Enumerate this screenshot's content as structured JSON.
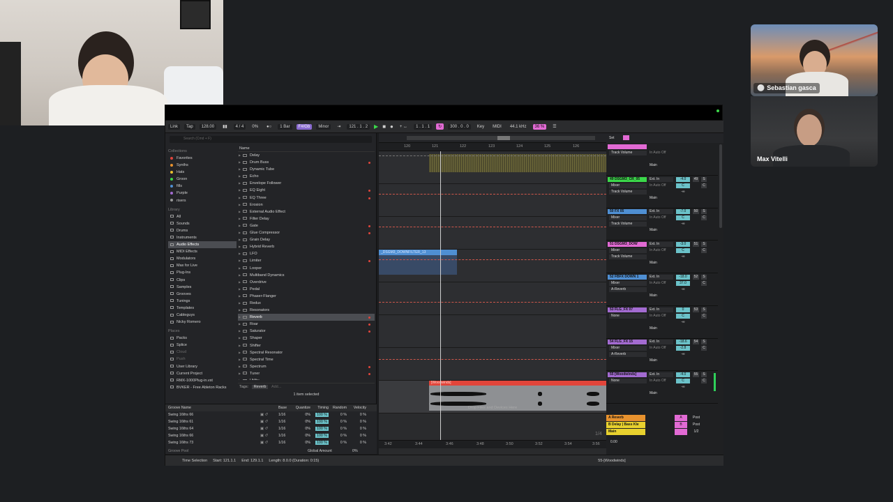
{
  "call": {
    "participants": [
      {
        "name": "Sebastian gasca",
        "muted": true
      },
      {
        "name": "Max Vitelli",
        "muted": false
      }
    ]
  },
  "control_bar": {
    "link": "Link",
    "tap": "Tap",
    "tempo": "128.00",
    "time_signature": "4 / 4",
    "percent": "0%",
    "loop_len": "1 Bar",
    "key": "F#/Gb",
    "scale": "Minor",
    "position": "121 .  1 .  2",
    "loop_start": "1 .  1 .  1",
    "loop_end": "300 .  0 .  0",
    "key_btn": "Key",
    "midi": "MIDI",
    "sample_rate": "44.1 kHz",
    "cpu": "36 %"
  },
  "browser": {
    "search_placeholder": "Search (Cmd + F)",
    "sidebar": {
      "collections_title": "Collections",
      "collections": [
        {
          "label": "Favorites",
          "color": "#e0453c"
        },
        {
          "label": "Synths",
          "color": "#e8922e"
        },
        {
          "label": "Hats",
          "color": "#e8c12e"
        },
        {
          "label": "Groon",
          "color": "#3bd84a"
        },
        {
          "label": "fills",
          "color": "#4f8fd3"
        },
        {
          "label": "Purple",
          "color": "#a36bd1"
        },
        {
          "label": "risers",
          "color": "#9a9a9a"
        }
      ],
      "library_title": "Library",
      "library": [
        "All",
        "Sounds",
        "Drums",
        "Instruments",
        "Audio Effects",
        "MIDI Effects",
        "Modulators",
        "Max for Live",
        "Plug-Ins",
        "Clips",
        "Samples",
        "Grooves",
        "Tunings",
        "Templates",
        "Cableguys",
        "Nicky Romero"
      ],
      "library_selected": 4,
      "places_title": "Places",
      "places": [
        "Packs",
        "Splice",
        "Cloud",
        "Push",
        "User Library",
        "Current Project",
        "RMX-1000Plug-in.vst",
        "BVKER - Free Ableton Racks"
      ]
    },
    "name_header": "Name",
    "items": [
      {
        "label": "Delay",
        "dot": false
      },
      {
        "label": "Drum Buss",
        "dot": true
      },
      {
        "label": "Dynamic Tube",
        "dot": false
      },
      {
        "label": "Echo",
        "dot": false
      },
      {
        "label": "Envelope Follower",
        "dot": false
      },
      {
        "label": "EQ Eight",
        "dot": true
      },
      {
        "label": "EQ Three",
        "dot": true
      },
      {
        "label": "Erosion",
        "dot": false
      },
      {
        "label": "External Audio Effect",
        "dot": false
      },
      {
        "label": "Filter Delay",
        "dot": false
      },
      {
        "label": "Gate",
        "dot": true
      },
      {
        "label": "Glue Compressor",
        "dot": true
      },
      {
        "label": "Grain Delay",
        "dot": false
      },
      {
        "label": "Hybrid Reverb",
        "dot": false
      },
      {
        "label": "LFO",
        "dot": false
      },
      {
        "label": "Limiter",
        "dot": true
      },
      {
        "label": "Looper",
        "dot": false
      },
      {
        "label": "Multiband Dynamics",
        "dot": false
      },
      {
        "label": "Overdrive",
        "dot": false
      },
      {
        "label": "Pedal",
        "dot": false
      },
      {
        "label": "Phaser-Flanger",
        "dot": false
      },
      {
        "label": "Redux",
        "dot": false
      },
      {
        "label": "Resonators",
        "dot": false
      },
      {
        "label": "Reverb",
        "dot": true
      },
      {
        "label": "Roar",
        "dot": true
      },
      {
        "label": "Saturator",
        "dot": true
      },
      {
        "label": "Shaper",
        "dot": false
      },
      {
        "label": "Shifter",
        "dot": false
      },
      {
        "label": "Spectral Resonator",
        "dot": false
      },
      {
        "label": "Spectral Time",
        "dot": false
      },
      {
        "label": "Spectrum",
        "dot": true
      },
      {
        "label": "Tuner",
        "dot": true
      },
      {
        "label": "Utility",
        "dot": true
      }
    ],
    "selected_index": 23,
    "tags_label": "Tags:",
    "tag_value": "Reverb",
    "tag_add": "Add...",
    "selected_count": "1 item selected"
  },
  "groove_pool": {
    "headers": {
      "name": "Groove Name",
      "base": "Base",
      "quantize": "Quantize",
      "timing": "Timing",
      "random": "Random",
      "velocity": "Velocity"
    },
    "rows": [
      {
        "name": "Swing 16ths 66",
        "base": "1/16",
        "quantize": "0%",
        "timing": "100 %",
        "random": "0 %",
        "velocity": "0 %"
      },
      {
        "name": "Swing 16ths 61",
        "base": "1/16",
        "quantize": "0%",
        "timing": "100 %",
        "random": "0 %",
        "velocity": "0 %"
      },
      {
        "name": "Swing 16ths 64",
        "base": "1/16",
        "quantize": "0%",
        "timing": "100 %",
        "random": "0 %",
        "velocity": "0 %"
      },
      {
        "name": "Swing 16ths 66",
        "base": "1/16",
        "quantize": "0%",
        "timing": "100 %",
        "random": "0 %",
        "velocity": "0 %"
      },
      {
        "name": "Swing 16ths 73",
        "base": "1/16",
        "quantize": "0%",
        "timing": "100 %",
        "random": "0 %",
        "velocity": "0 %"
      }
    ],
    "footer_label": "Groove Pool",
    "global_amount_label": "Global Amount",
    "global_amount": "0%"
  },
  "arrangement": {
    "bar_ticks": [
      "120",
      "121",
      "122",
      "123",
      "124",
      "125",
      "126"
    ],
    "time_ticks": [
      "3:42",
      "3:44",
      "3:46",
      "3:48",
      "3:50",
      "3:52",
      "3:54",
      "3:56"
    ],
    "clip_blue_label": "_DSGM3_DOWNFILTER_13",
    "clip_red_label": "[Woodwinds]",
    "drop_hint": "Drop Files and Devices Here",
    "time_sig_display": "1/4"
  },
  "mixer": {
    "set_label": "Set",
    "strips": [
      {
        "name": "",
        "color": "#e26ad4",
        "sel1": "Track Volume",
        "sel2": "",
        "io": "",
        "num": "",
        "vol": "",
        "pan": "",
        "out": "Main"
      },
      {
        "name": "49 DSGM3_CR_05",
        "color": "#3bd84a",
        "sel1": "Mixer",
        "sel2": "Track Volume",
        "io": "Ext. In",
        "num": "49",
        "vol": "-4.0",
        "pan": "C",
        "out": "Main"
      },
      {
        "name": "50 FX 05",
        "color": "#4f8fd3",
        "sel1": "Mixer",
        "sel2": "Track Volume",
        "io": "Ext. In",
        "num": "50",
        "vol": "-7.0",
        "pan": "C",
        "out": "Main"
      },
      {
        "name": "51 DSGM3_DOW",
        "color": "#e26ad4",
        "sel1": "Mixer",
        "sel2": "Track Volume",
        "io": "Ext. In",
        "num": "51",
        "vol": "-3.0",
        "pan": "C",
        "out": "Main"
      },
      {
        "name": "52 FBFX DOWN 1",
        "color": "#4f8fd3",
        "sel1": "Mixer",
        "sel2": "A-Reverb",
        "io": "Ext. In",
        "num": "52",
        "vol": "-18.0",
        "pan": "37.0",
        "out": "Main"
      },
      {
        "name": "53 FLG_FX 07",
        "color": "#a36bd1",
        "sel1": "None",
        "sel2": "",
        "io": "Ext. In",
        "num": "53",
        "vol": "0",
        "pan": "C",
        "out": "Main"
      },
      {
        "name": "54 FLG_FX 15",
        "color": "#a36bd1",
        "sel1": "Mixer",
        "sel2": "A-Reverb",
        "io": "Ext. In",
        "num": "54",
        "vol": "-18.6",
        "pan": "-2.8",
        "out": "Main"
      },
      {
        "name": "55 [Woodwinds]",
        "color": "#a36bd1",
        "sel1": "None",
        "sel2": "",
        "io": "Ext. In",
        "num": "55",
        "vol": "-4.0",
        "pan": "C",
        "out": "Main"
      }
    ],
    "returns": [
      {
        "name": "A Reverb",
        "color": "#e8922e",
        "letter": "A",
        "post": "Post"
      },
      {
        "name": "B Delay | Bass Kle",
        "color": "#e8d12e",
        "letter": "B",
        "post": "Post"
      },
      {
        "name": "Main",
        "color": "#e8d12e",
        "letter": "",
        "post": "1/2"
      }
    ],
    "main_vol": "0.00"
  },
  "status_bar": {
    "mode": "Time Selection",
    "start": "Start: 121.1.1",
    "end": "End: 129.1.1",
    "length": "Length: 8.0.0 (Duration: 0:15)",
    "selected_track": "55-[Woodwinds]"
  }
}
